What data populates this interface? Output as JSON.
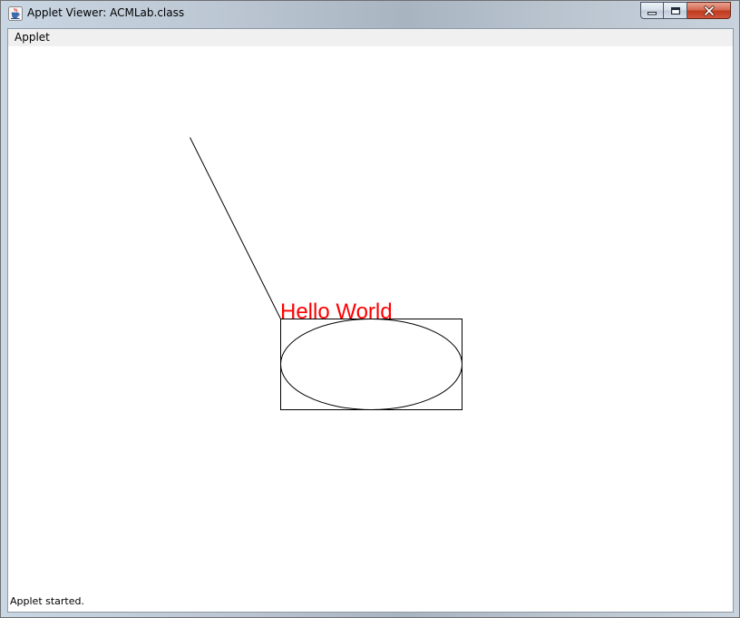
{
  "window": {
    "title": "Applet Viewer: ACMLab.class",
    "icon": "java-cup-icon",
    "controls": {
      "minimize_icon": "minimize-icon",
      "maximize_icon": "maximize-icon",
      "close_icon": "close-icon"
    }
  },
  "menubar": {
    "items": [
      {
        "label": "Applet"
      }
    ]
  },
  "canvas": {
    "label_text": "Hello World",
    "label_color": "#ff0000",
    "stroke_color": "#000000"
  },
  "status": {
    "text": "Applet started."
  }
}
